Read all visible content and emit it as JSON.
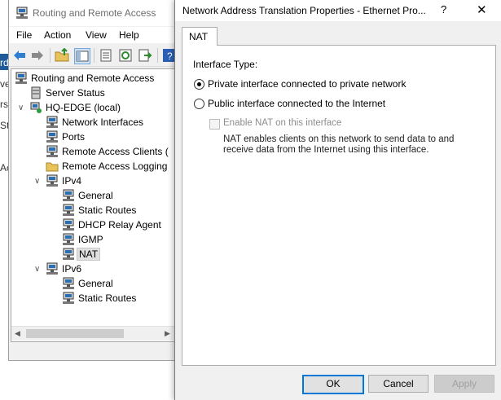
{
  "background_fragments": [
    "rd",
    "ve",
    "rs",
    "St",
    "Ac"
  ],
  "mmc": {
    "title": "Routing and Remote Access",
    "menu": [
      "File",
      "Action",
      "View",
      "Help"
    ],
    "tree": {
      "root": "Routing and Remote Access",
      "server_status": "Server Status",
      "server": "HQ-EDGE (local)",
      "network_interfaces": "Network Interfaces",
      "ports": "Ports",
      "remote_access_clients": "Remote Access Clients (",
      "remote_access_logging": "Remote Access Logging",
      "ipv4": "IPv4",
      "ipv4_items": [
        "General",
        "Static Routes",
        "DHCP Relay Agent",
        "IGMP",
        "NAT"
      ],
      "ipv6": "IPv6",
      "ipv6_items": [
        "General",
        "Static Routes"
      ]
    }
  },
  "dialog": {
    "title": "Network Address Translation Properties - Ethernet Pro...",
    "help": "?",
    "close": "✕",
    "tab": "NAT",
    "interface_type_label": "Interface Type:",
    "private_option": "Private interface connected to private network",
    "public_option": "Public interface connected to the Internet",
    "enable_nat": "Enable NAT on this interface",
    "description": "NAT enables clients on this network to send data to and receive data from the Internet using this interface.",
    "selected": "private",
    "buttons": {
      "ok": "OK",
      "cancel": "Cancel",
      "apply": "Apply"
    }
  },
  "colors": {
    "accent": "#0078d7",
    "selection": "#e0e0e0"
  }
}
